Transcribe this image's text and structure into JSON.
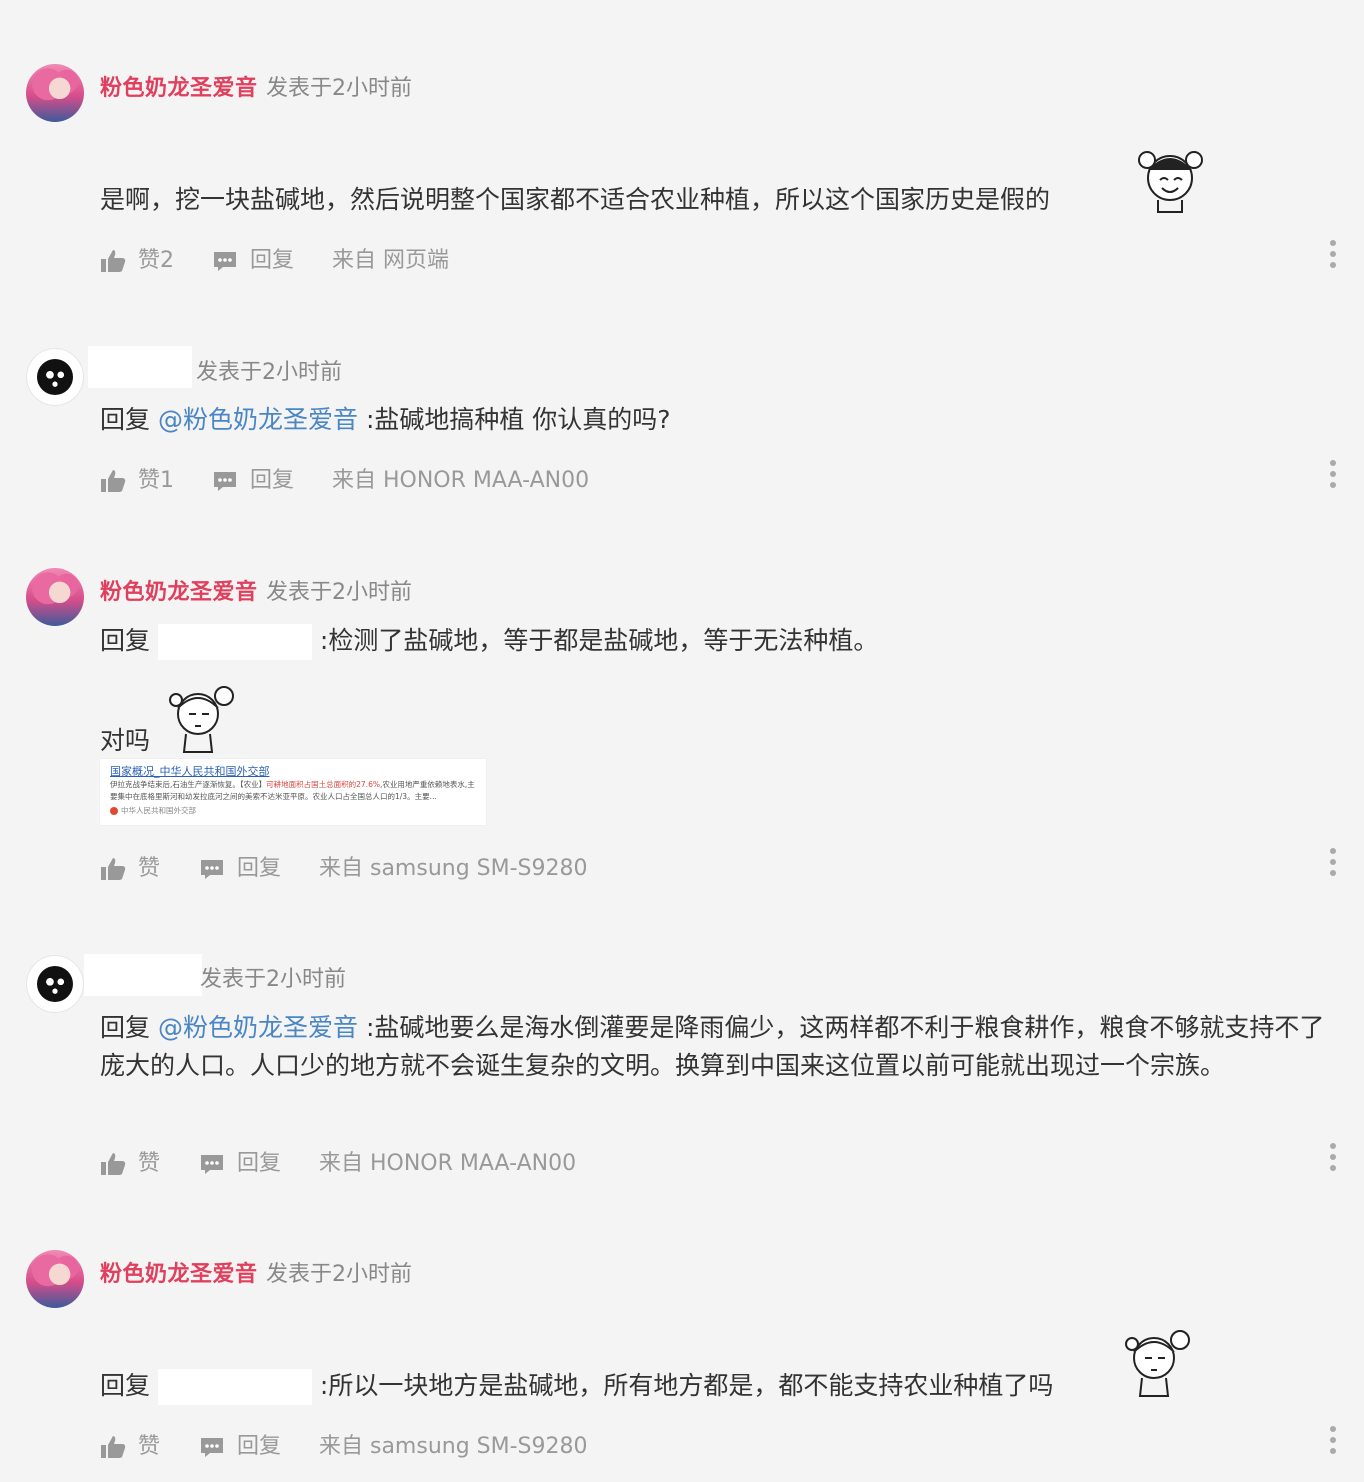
{
  "comments": [
    {
      "author": "粉色奶龙圣爱音",
      "time": "发表于2小时前",
      "body": "是啊，挖一块盐碱地，然后说明整个国家都不适合农业种植，所以这个国家历史是假的",
      "likes": "赞2",
      "reply": "回复",
      "source": "来自 网页端"
    },
    {
      "time": "发表于2小时前",
      "reply_prefix": "回复",
      "mention": "@粉色奶龙圣爱音",
      "body": " :盐碱地搞种植  你认真的吗?",
      "likes": "赞1",
      "reply": "回复",
      "source": "来自 HONOR  MAA-AN00"
    },
    {
      "author": "粉色奶龙圣爱音",
      "time": "发表于2小时前",
      "reply_prefix": "回复",
      "body": ":检测了盐碱地，等于都是盐碱地，等于无法种植。",
      "body2": "对吗",
      "card": {
        "title": "国家概况_中华人民共和国外交部",
        "text_a": "伊拉克战争结束后,石油生产逐渐恢复。【农业】",
        "highlight": "可耕地面积占国土总面积的27.6%",
        "text_b": ",农业用地严重依赖地表水,主要集中在底格里斯河和幼发拉底河之间的美索不达米亚平原。农业人口占全国总人口的1/3。主要...",
        "source": "中华人民共和国外交部"
      },
      "likes": "赞",
      "reply": "回复",
      "source": "来自 samsung  SM-S9280"
    },
    {
      "time": "发表于2小时前",
      "reply_prefix": "回复",
      "mention": "@粉色奶龙圣爱音",
      "body": " :盐碱地要么是海水倒灌要是降雨偏少，这两样都不利于粮食耕作，粮食不够就支持不了庞大的人口。人口少的地方就不会诞生复杂的文明。换算到中国来这位置以前可能就出现过一个宗族。",
      "likes": "赞",
      "reply": "回复",
      "source": "来自 HONOR  MAA-AN00"
    },
    {
      "author": "粉色奶龙圣爱音",
      "time": "发表于2小时前",
      "reply_prefix": "回复",
      "body": ":所以一块地方是盐碱地，所有地方都是，都不能支持农业种植了吗",
      "likes": "赞",
      "reply": "回复",
      "source": "来自 samsung  SM-S9280"
    }
  ],
  "icons": {
    "like": "thumbs-up-icon",
    "reply": "speech-bubble-icon",
    "more": "more-vertical-icon"
  },
  "colors": {
    "author": "#e0405e",
    "mention": "#4a86c5",
    "meta": "#999999"
  }
}
